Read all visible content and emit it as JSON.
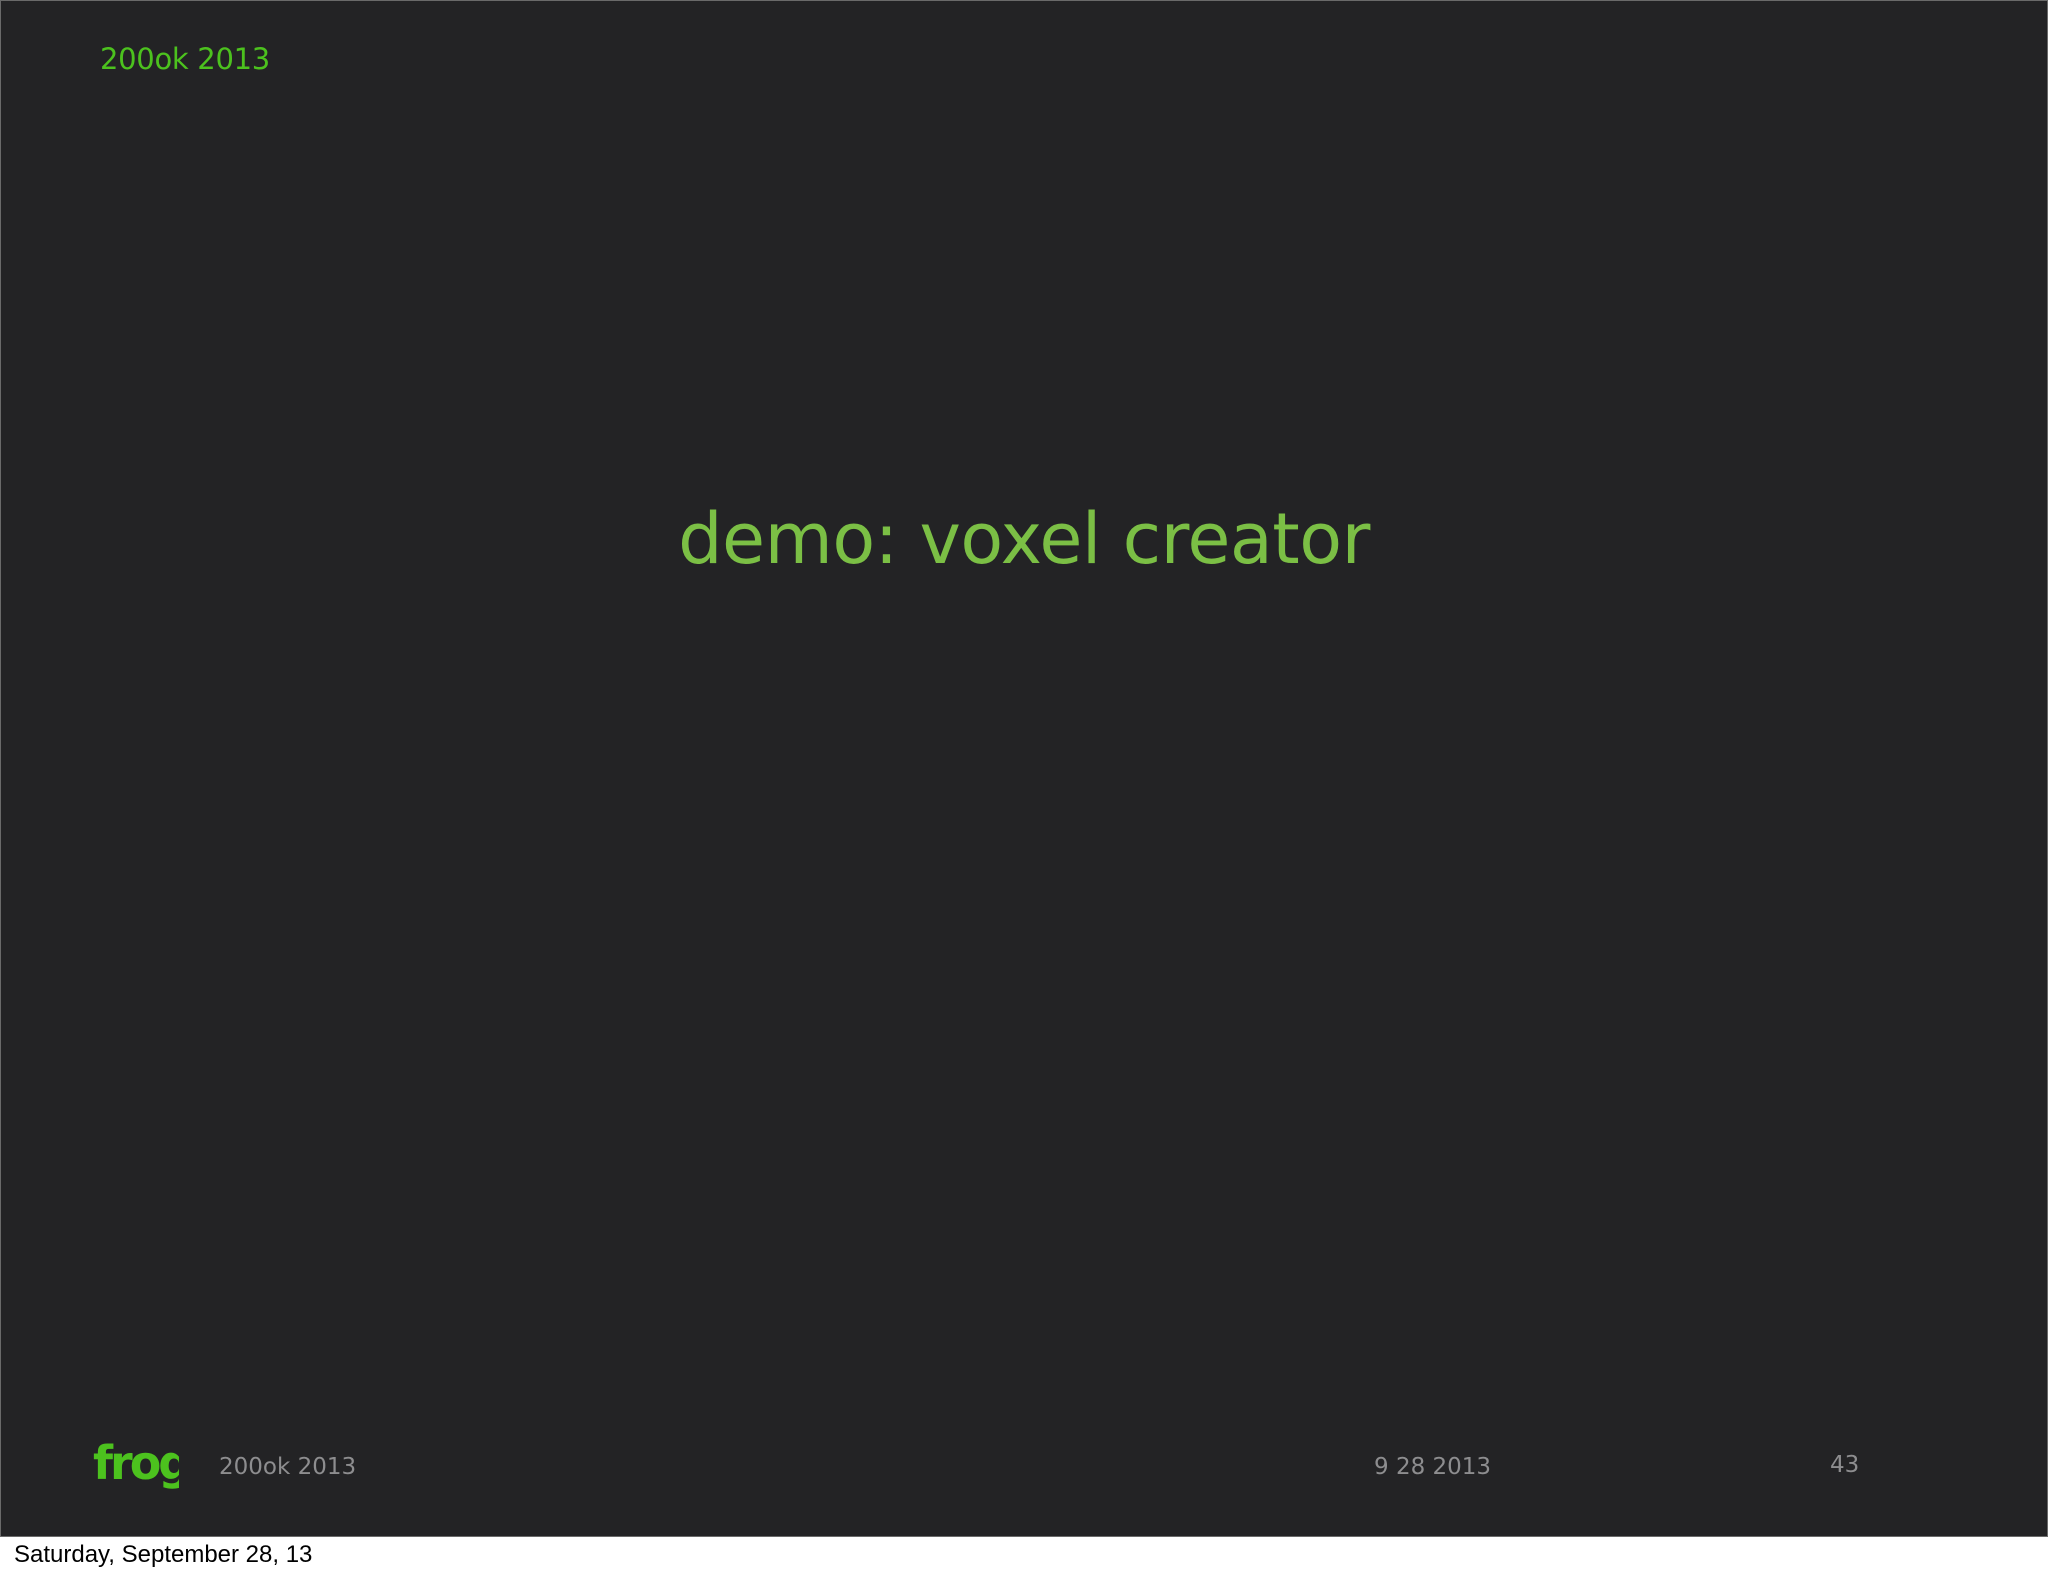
{
  "slide": {
    "header_title": "200ok 2013",
    "main_title": "demo: voxel creator",
    "footer": {
      "logo_text": "frog",
      "event_name": "200ok 2013",
      "date": "9 28 2013",
      "page_number": "43"
    }
  },
  "caption": "Saturday, September 28, 13",
  "colors": {
    "background": "#232325",
    "accent_green": "#4cc21e",
    "title_green": "#7bbf45",
    "footer_gray": "#8d8d8f"
  }
}
